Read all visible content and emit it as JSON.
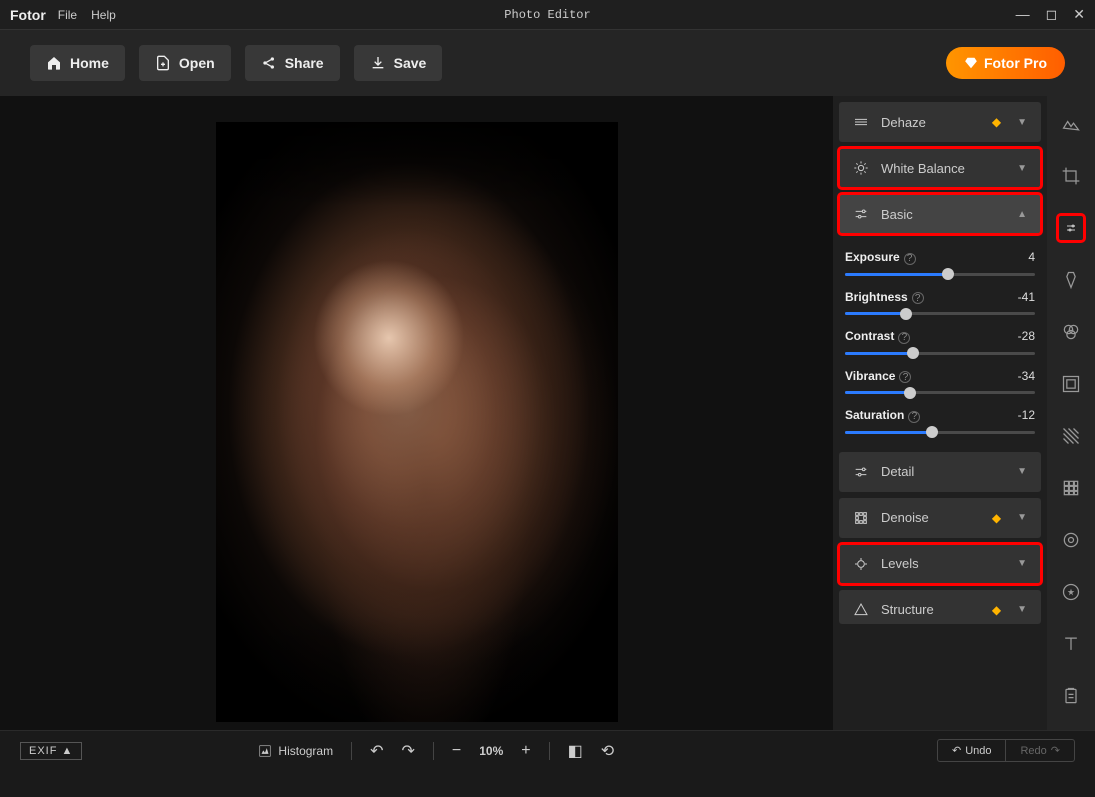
{
  "titlebar": {
    "app": "Fotor",
    "menu": [
      "File",
      "Help"
    ],
    "title": "Photo Editor"
  },
  "toolbar": {
    "home": "Home",
    "open": "Open",
    "share": "Share",
    "save": "Save",
    "pro": "Fotor Pro"
  },
  "panels": {
    "dehaze": "Dehaze",
    "white_balance": "White Balance",
    "basic": "Basic",
    "detail": "Detail",
    "denoise": "Denoise",
    "levels": "Levels",
    "structure": "Structure"
  },
  "sliders": [
    {
      "name": "Exposure",
      "value": 4,
      "pct": 54
    },
    {
      "name": "Brightness",
      "value": -41,
      "pct": 32
    },
    {
      "name": "Contrast",
      "value": -28,
      "pct": 36
    },
    {
      "name": "Vibrance",
      "value": -34,
      "pct": 34
    },
    {
      "name": "Saturation",
      "value": -12,
      "pct": 46
    }
  ],
  "bottom": {
    "exif": "EXIF",
    "histogram": "Histogram",
    "zoom": "10%",
    "undo": "Undo",
    "redo": "Redo"
  }
}
